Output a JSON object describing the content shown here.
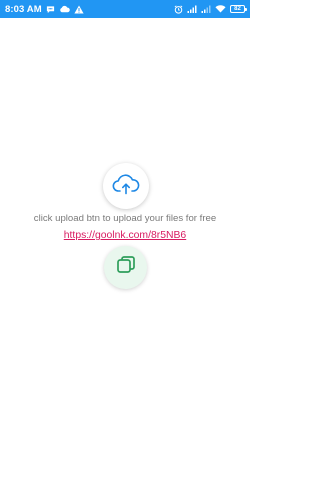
{
  "status_bar": {
    "time": "8:03 AM",
    "battery_level": "82",
    "left_icons": [
      "chat-icon",
      "cloud-icon",
      "warning-icon"
    ],
    "right_icons": [
      "alarm-icon",
      "signal-icon",
      "signal-icon",
      "wifi-icon",
      "battery-icon"
    ],
    "background_color": "#2196f3"
  },
  "main": {
    "upload_icon": "cloud-upload-icon",
    "hint_text": "click upload btn to upload your files for free",
    "link_text": "https://goolnk.com/8r5NB6",
    "link_color": "#d81b60",
    "copy_icon": "copy-icon",
    "accent_color": "#1e88e5",
    "copy_color": "#2e9e5b"
  }
}
